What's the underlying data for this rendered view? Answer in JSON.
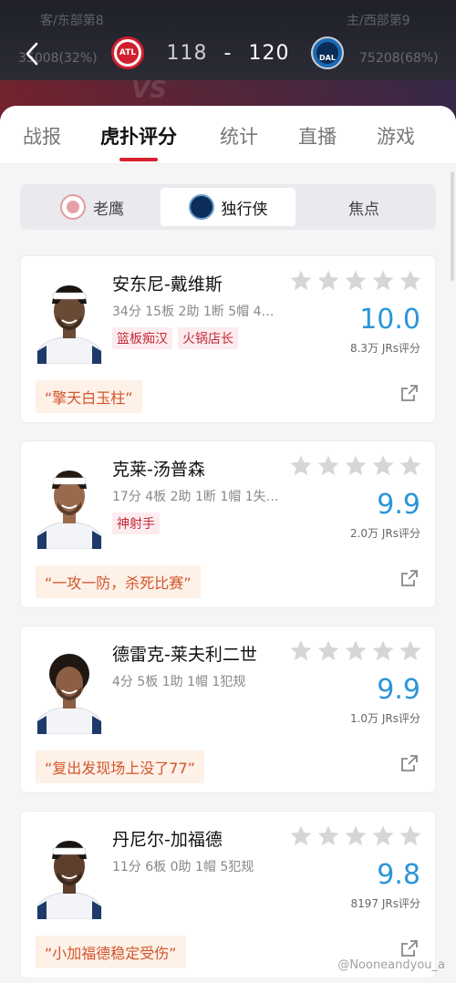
{
  "header": {
    "away_info": "客/东部第8",
    "home_info": "主/西部第9",
    "away_score": "118",
    "separator": "-",
    "home_score": "120",
    "away_support": "35008(32%)",
    "home_support": "75208(68%)",
    "away_logo": "ATL",
    "home_logo": "DAL",
    "vs_text": "VS"
  },
  "tabs": [
    {
      "label": "战报"
    },
    {
      "label": "虎扑评分"
    },
    {
      "label": "统计"
    },
    {
      "label": "直播"
    },
    {
      "label": "游戏"
    }
  ],
  "segment": {
    "team_a": "老鹰",
    "team_b": "独行侠",
    "focus": "焦点",
    "team_a_logo": "ATL",
    "team_b_logo": "DAL"
  },
  "players": [
    {
      "name": "安东尼-戴维斯",
      "stats": "34分 15板 2助 1断 5帽 4失…",
      "tags": [
        "篮板痴汉",
        "火锅店长"
      ],
      "rating": "10.0",
      "count": "8.3万 JRs评分",
      "quote": "“擎天白玉柱”"
    },
    {
      "name": "克莱-汤普森",
      "stats": "17分 4板 2助 1断 1帽 1失…",
      "tags": [
        "神射手"
      ],
      "rating": "9.9",
      "count": "2.0万 JRs评分",
      "quote": "“一攻一防，杀死比赛”"
    },
    {
      "name": "德雷克-莱夫利二世",
      "stats": "4分 5板 1助 1帽 1犯规",
      "tags": [],
      "rating": "9.9",
      "count": "1.0万 JRs评分",
      "quote": "“复出发现场上没了77”"
    },
    {
      "name": "丹尼尔-加福德",
      "stats": "11分 6板 0助 1帽 5犯规",
      "tags": [],
      "rating": "9.8",
      "count": "8197 JRs评分",
      "quote": "“小加福德稳定受伤”"
    }
  ],
  "watermark": "@Nooneandyou_a",
  "colors": {
    "accent_red": "#d82030",
    "rating_blue": "#2b96d8",
    "quote_orange": "#d2552a"
  }
}
